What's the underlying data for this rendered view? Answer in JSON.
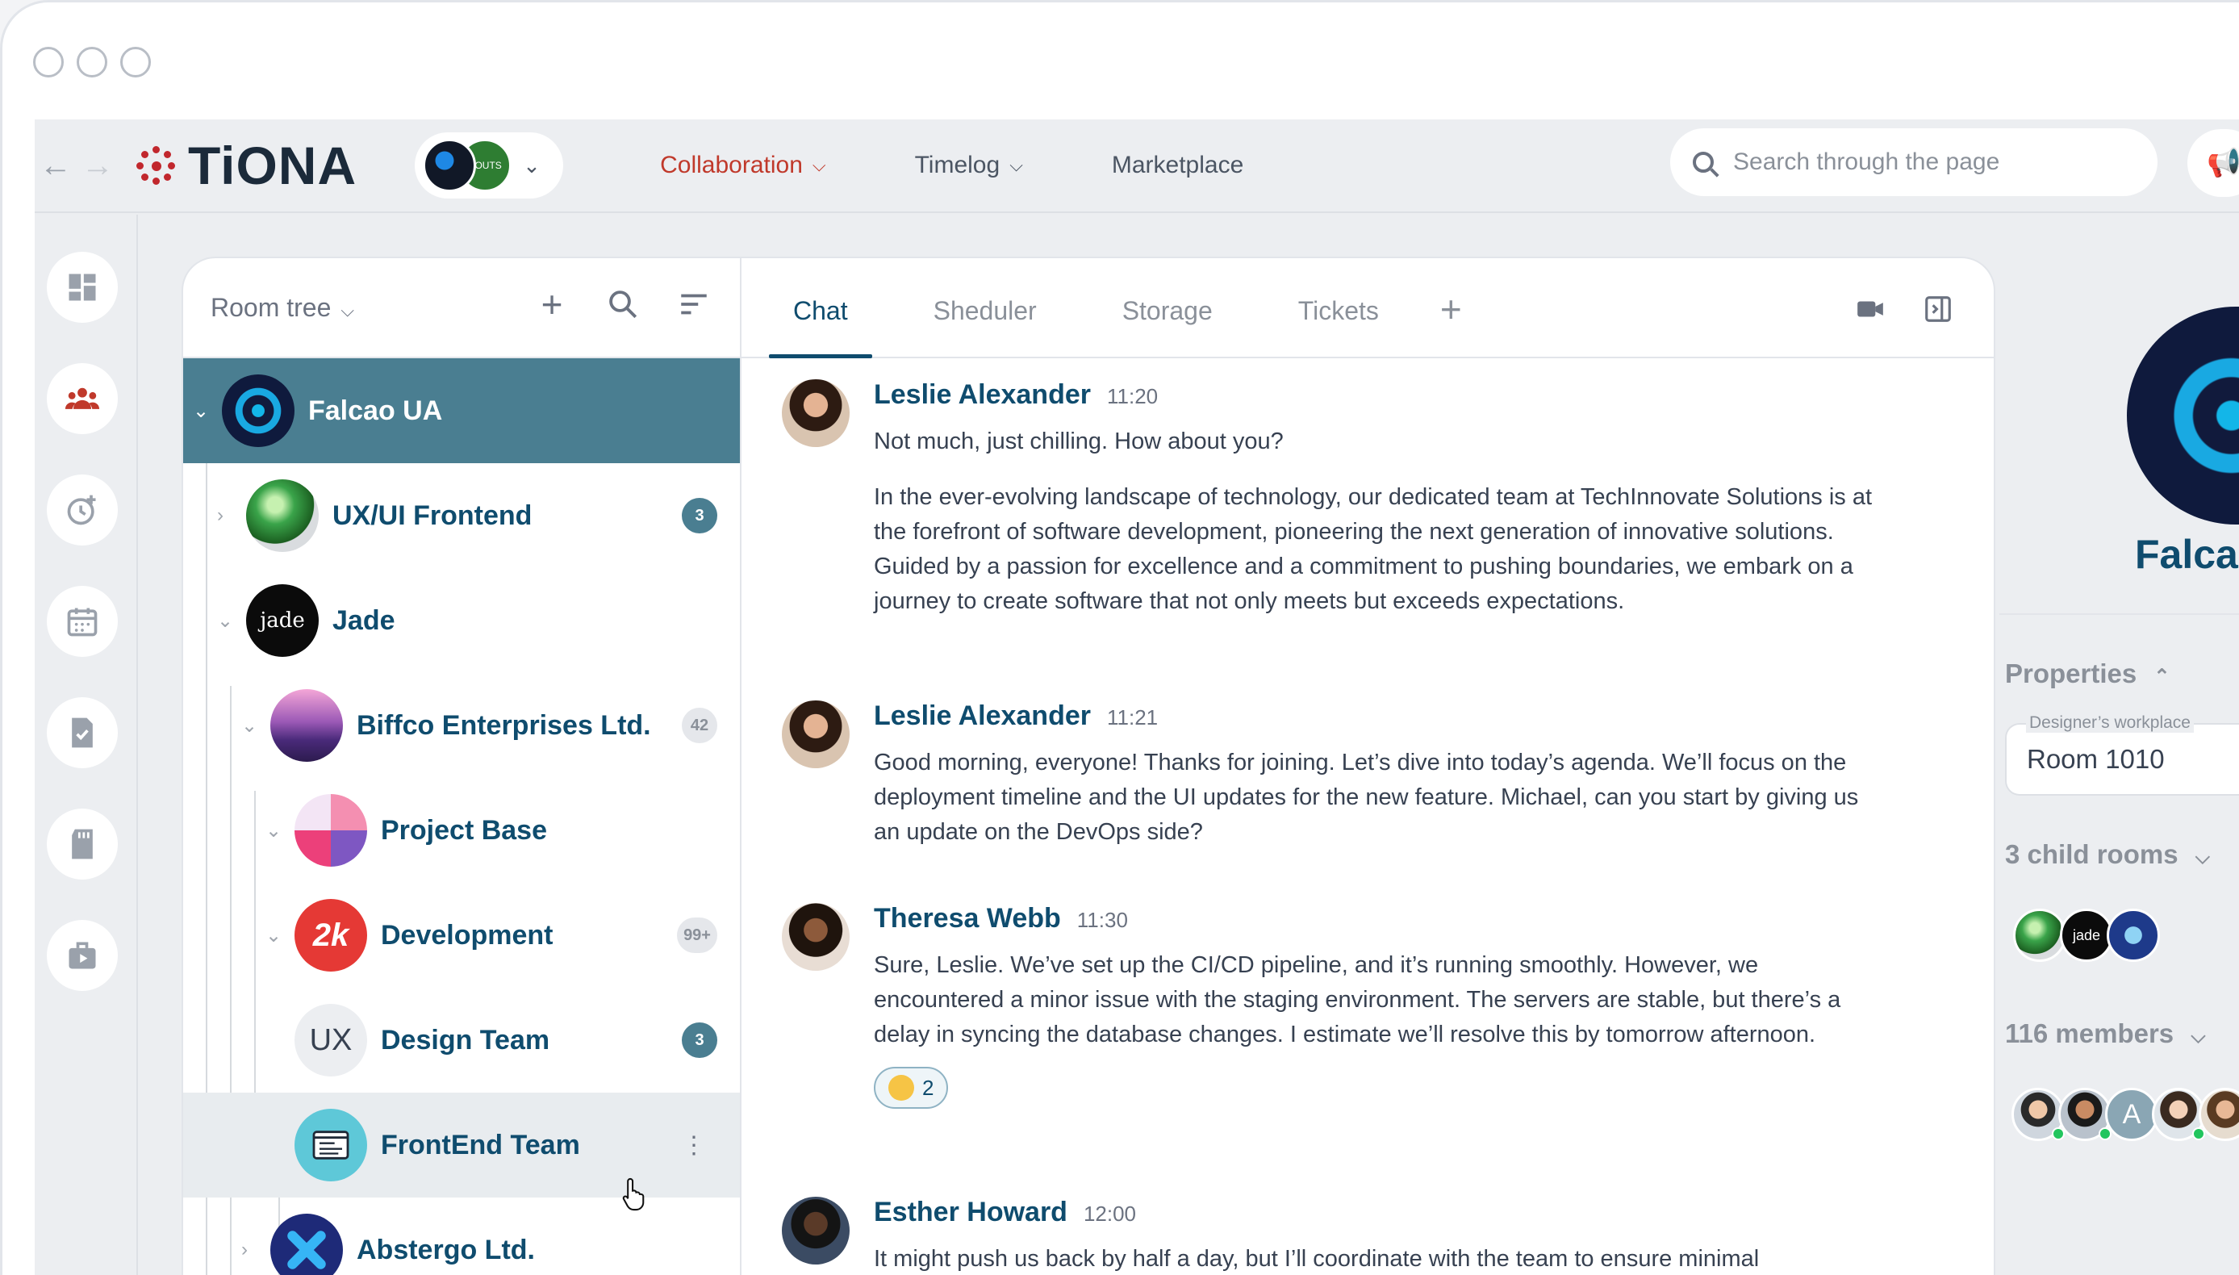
{
  "topbar": {
    "brand": "TiONA",
    "workspace_mini_label": "SOUTS",
    "nav": [
      {
        "label": "Collaboration",
        "active": true
      },
      {
        "label": "Timelog",
        "active": false
      },
      {
        "label": "Marketplace",
        "active": false
      }
    ],
    "search_placeholder": "Search through the page"
  },
  "rail": {
    "icons": [
      "dashboard-icon",
      "team-icon",
      "time-add-icon",
      "calendar-icon",
      "document-check-icon",
      "storage-icon",
      "briefcase-icon"
    ],
    "active_index": 1
  },
  "rooms": {
    "title": "Room tree",
    "items": [
      {
        "name": "Falcao UA",
        "level": 0,
        "selected": true,
        "badge": ""
      },
      {
        "name": "UX/UI Frontend",
        "level": 1,
        "badge": "3",
        "badge_style": "dark"
      },
      {
        "name": "Jade",
        "level": 1,
        "badge": "",
        "avatar_text": "jade"
      },
      {
        "name": "Biffco Enterprises Ltd.",
        "level": 2,
        "badge": "42",
        "badge_style": "light"
      },
      {
        "name": "Project Base",
        "level": 3,
        "badge": ""
      },
      {
        "name": "Development",
        "level": 3,
        "badge": "99+",
        "badge_style": "light",
        "avatar_text": "2k"
      },
      {
        "name": "Design Team",
        "level": 4,
        "badge": "3",
        "badge_style": "dark",
        "avatar_text": "UX"
      },
      {
        "name": "FrontEnd Team",
        "level": 4,
        "badge": "",
        "hovered": true
      },
      {
        "name": "Abstergo Ltd.",
        "level": 2,
        "badge": ""
      }
    ]
  },
  "chat": {
    "tabs": [
      "Chat",
      "Sheduler",
      "Storage",
      "Tickets"
    ],
    "active_tab": "Chat",
    "messages": [
      {
        "author": "Leslie Alexander",
        "time": "11:20",
        "paragraphs": [
          "Not much, just chilling. How about you?",
          "In the ever-evolving landscape of technology, our dedicated team at TechInnovate Solutions is at the forefront of software development, pioneering the next generation of innovative solutions. Guided by a passion for excellence and a commitment to pushing boundaries, we embark on a journey to create software that not only meets but exceeds expectations."
        ]
      },
      {
        "author": "Leslie Alexander",
        "time": "11:21",
        "paragraphs": [
          "Good morning, everyone! Thanks for joining. Let’s dive into today’s agenda. We’ll focus on the deployment timeline and the UI updates for the new feature. Michael, can you start by giving us an update on the DevOps side?"
        ]
      },
      {
        "author": "Theresa Webb",
        "time": "11:30",
        "paragraphs": [
          "Sure, Leslie. We’ve set up the CI/CD pipeline, and it’s running smoothly. However, we encountered a minor issue with the staging environment. The servers are stable, but there’s a delay in syncing the database changes. I estimate we’ll resolve this by tomorrow afternoon."
        ],
        "reaction_count": "2"
      },
      {
        "author": "Esther Howard",
        "time": "12:00",
        "paragraphs": [
          "It might push us back by half a day, but I’ll coordinate with the team to ensure minimal"
        ]
      }
    ]
  },
  "info": {
    "name": "Falcao UA",
    "properties_label": "Properties",
    "field_label": "Designer’s workplace",
    "field_value": "Room 1010",
    "child_rooms_label": "3 child rooms",
    "members_label": "116 members",
    "member_initial": "A"
  },
  "colors": {
    "accent": "#0f4c6e",
    "selected_row": "#4a7e91",
    "active_nav": "#c0392b",
    "online": "#22c55e"
  }
}
